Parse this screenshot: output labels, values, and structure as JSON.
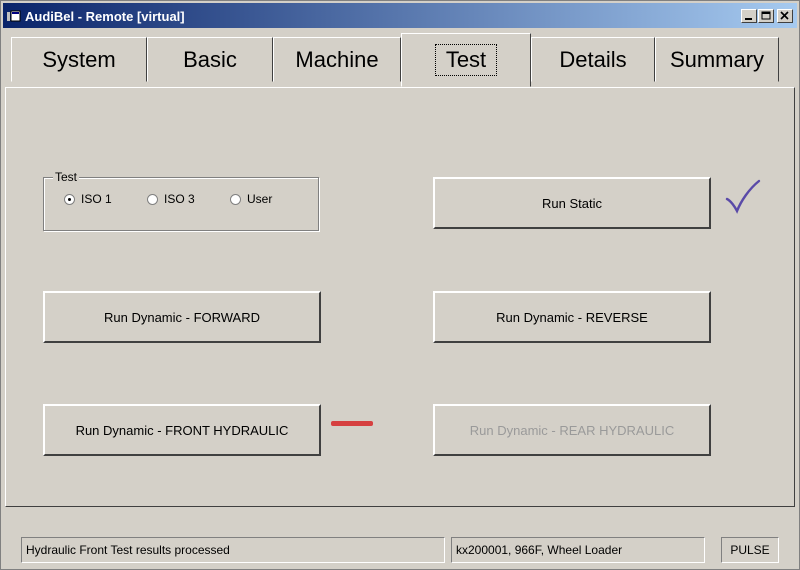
{
  "window": {
    "title": "AudiBel - Remote [virtual]"
  },
  "tabs": [
    {
      "label": "System"
    },
    {
      "label": "Basic"
    },
    {
      "label": "Machine"
    },
    {
      "label": "Test",
      "active": true
    },
    {
      "label": "Details"
    },
    {
      "label": "Summary"
    }
  ],
  "test_group": {
    "legend": "Test",
    "options": [
      {
        "label": "ISO 1",
        "selected": true
      },
      {
        "label": "ISO 3",
        "selected": false
      },
      {
        "label": "User",
        "selected": false
      }
    ]
  },
  "buttons": {
    "run_static": "Run Static",
    "run_forward": "Run Dynamic - FORWARD",
    "run_reverse": "Run Dynamic - REVERSE",
    "run_front_hydraulic": "Run Dynamic - FRONT HYDRAULIC",
    "run_rear_hydraulic": "Run Dynamic - REAR HYDRAULIC"
  },
  "indicators": {
    "static_status": "check-icon",
    "front_hydraulic_status": "dash-icon",
    "check_color": "#5a4aa8",
    "dash_color": "#d64040"
  },
  "statusbar": {
    "message": "Hydraulic Front Test results processed",
    "machine": "kx200001, 966F, Wheel Loader",
    "mode": "PULSE"
  }
}
